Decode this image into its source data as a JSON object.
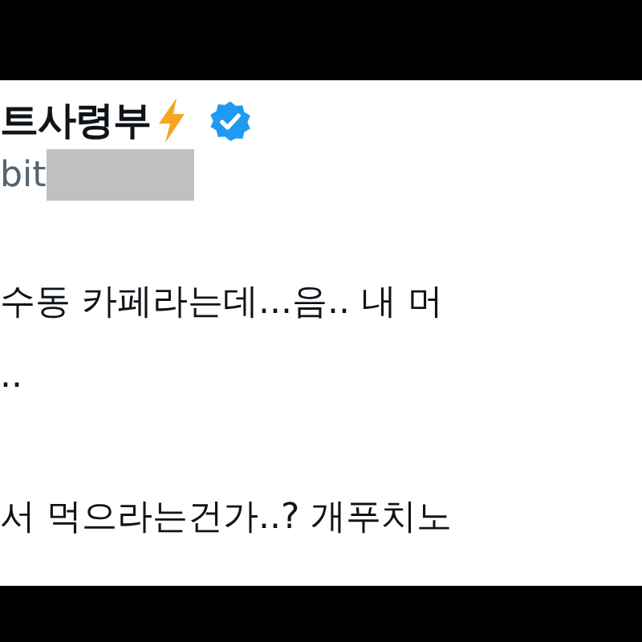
{
  "author": {
    "name": "트사령부",
    "handle": "bit",
    "verified": true
  },
  "tweet": {
    "paragraphs": [
      [
        "수동 카페라는데...음.. 내 머",
        ".."
      ],
      [
        "서 먹으라는건가..? 개푸치노"
      ]
    ]
  }
}
